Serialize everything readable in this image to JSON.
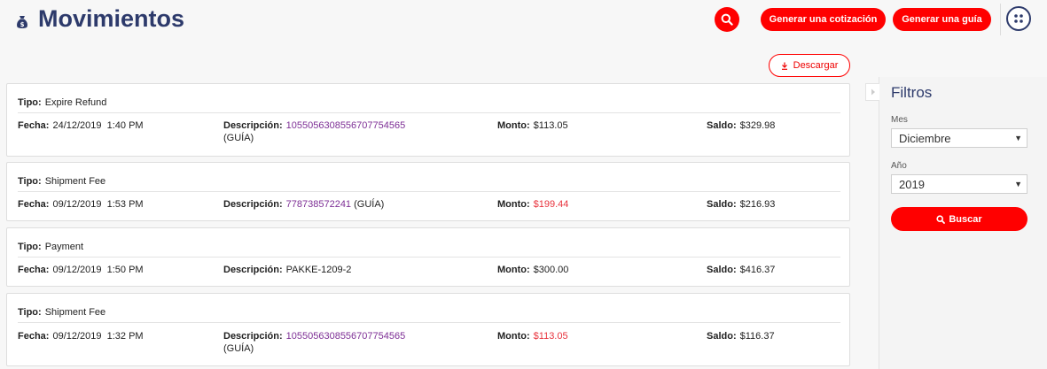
{
  "header": {
    "title": "Movimientos",
    "generate_quote_label": "Generar una cotización",
    "generate_guide_label": "Generar una guía"
  },
  "download_label": "Descargar",
  "labels": {
    "tipo": "Tipo:",
    "fecha": "Fecha:",
    "descripcion": "Descripción:",
    "monto": "Monto:",
    "saldo": "Saldo:"
  },
  "movements": [
    {
      "tipo": "Expire Refund",
      "fecha": "24/12/2019  1:40 PM",
      "descripcion_link": "1055056308556707754565",
      "descripcion_suffix": "(GUÍA)",
      "monto": "$113.05",
      "saldo": "$329.98"
    },
    {
      "tipo": "Shipment Fee",
      "fecha": "09/12/2019  1:53 PM",
      "descripcion_link": "778738572241",
      "descripcion_suffix": "(GUÍA)",
      "monto": "$199.44",
      "saldo": "$216.93"
    },
    {
      "tipo": "Payment",
      "fecha": "09/12/2019  1:50 PM",
      "descripcion_text": "PAKKE-1209-2",
      "monto": "$300.00",
      "saldo": "$416.37"
    },
    {
      "tipo": "Shipment Fee",
      "fecha": "09/12/2019  1:32 PM",
      "descripcion_link": "1055056308556707754565",
      "descripcion_suffix": "(GUÍA)",
      "monto": "$113.05",
      "saldo": "$116.37"
    }
  ],
  "filters": {
    "title": "Filtros",
    "month_label": "Mes",
    "month_value": "Diciembre",
    "year_label": "Año",
    "year_value": "2019",
    "search_label": "Buscar"
  },
  "colors": {
    "accent": "#ff0000",
    "title": "#2d3a6b",
    "link": "#7d2e95",
    "negative": "#e8323c"
  }
}
